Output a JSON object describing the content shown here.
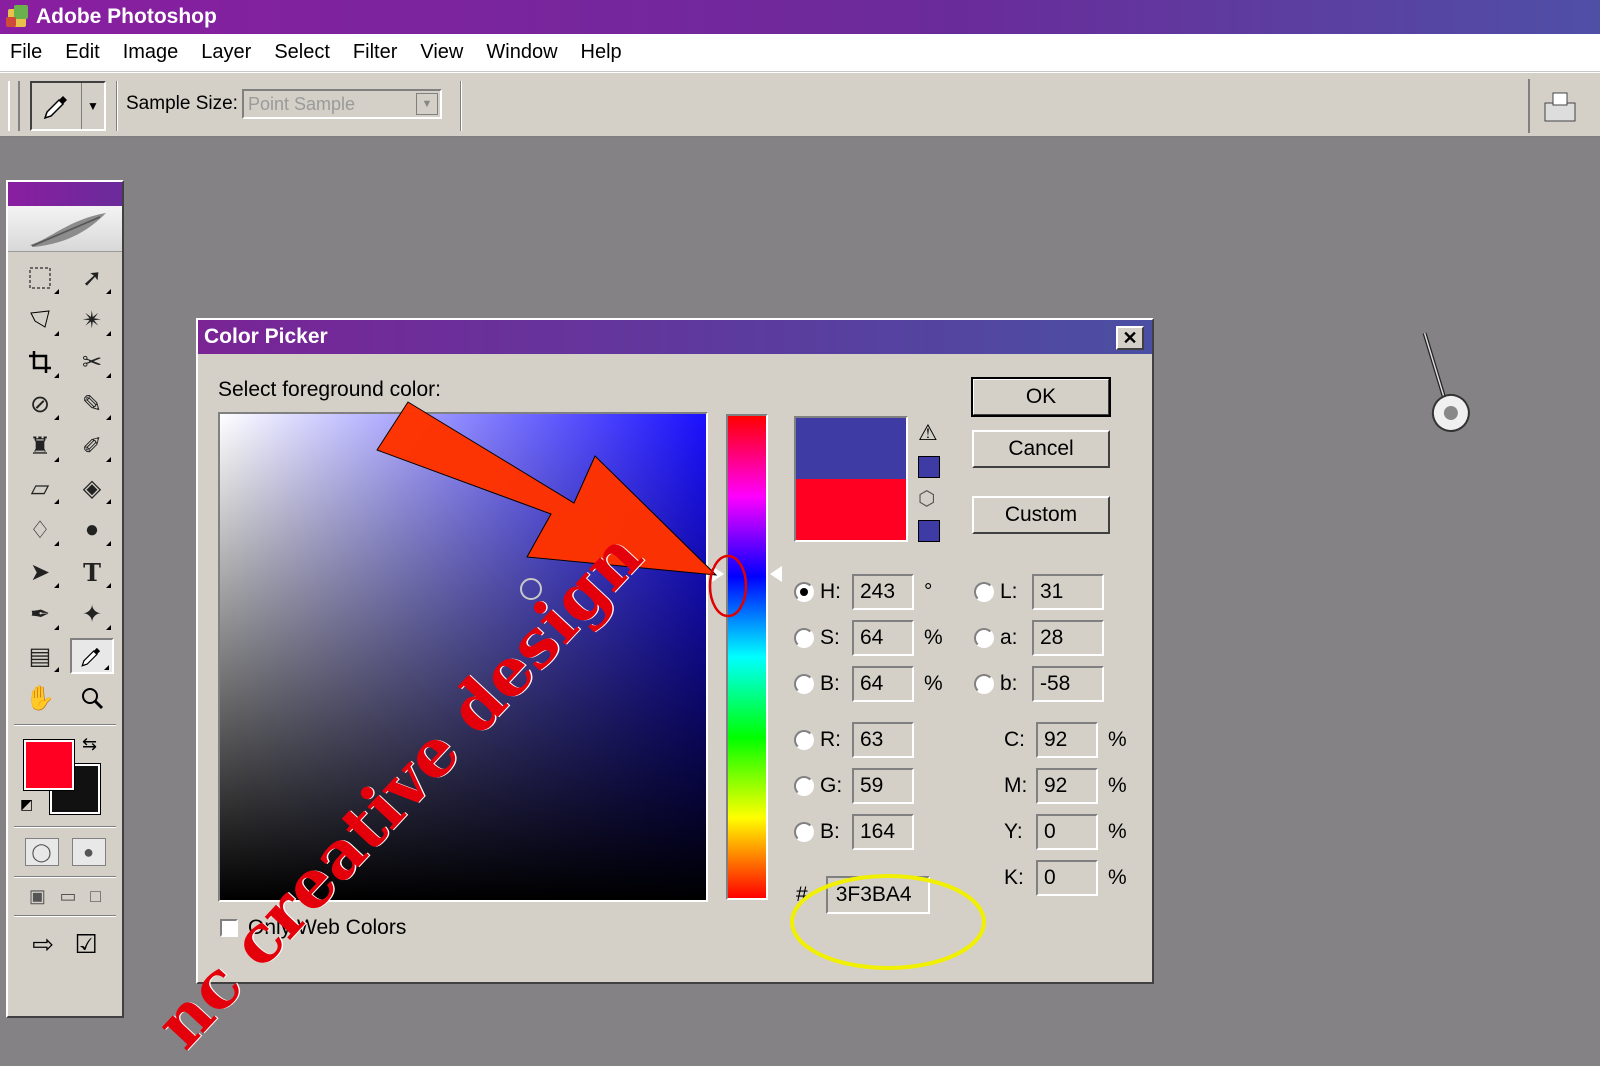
{
  "app": {
    "title": "Adobe Photoshop"
  },
  "menu": [
    "File",
    "Edit",
    "Image",
    "Layer",
    "Select",
    "Filter",
    "View",
    "Window",
    "Help"
  ],
  "options": {
    "sample_size_label": "Sample Size:",
    "sample_size_value": "Point Sample"
  },
  "toolbox": {
    "foreground_color": "#ff0022",
    "background_color": "#111111",
    "tools": [
      "marquee",
      "move",
      "lasso",
      "magic-wand",
      "crop",
      "slice",
      "healing-brush",
      "brush",
      "clone-stamp",
      "history-brush",
      "eraser",
      "paint-bucket",
      "blur",
      "dodge",
      "path-selection",
      "type",
      "pen",
      "custom-shape",
      "notes",
      "eyedropper",
      "hand",
      "zoom"
    ]
  },
  "dialog": {
    "title": "Color Picker",
    "close_label": "✕",
    "prompt": "Select foreground color:",
    "new_color": "#3f3ba4",
    "current_color": "#ff0022",
    "hue_base_color": "#1a10ff",
    "buttons": {
      "ok": "OK",
      "cancel": "Cancel",
      "custom": "Custom"
    },
    "hsb": {
      "h": {
        "label": "H:",
        "value": "243",
        "unit": "°",
        "selected": true
      },
      "s": {
        "label": "S:",
        "value": "64",
        "unit": "%"
      },
      "b": {
        "label": "B:",
        "value": "64",
        "unit": "%"
      }
    },
    "rgb": {
      "r": {
        "label": "R:",
        "value": "63"
      },
      "g": {
        "label": "G:",
        "value": "59"
      },
      "b": {
        "label": "B:",
        "value": "164"
      }
    },
    "lab": {
      "l": {
        "label": "L:",
        "value": "31"
      },
      "a": {
        "label": "a:",
        "value": "28"
      },
      "b": {
        "label": "b:",
        "value": "-58"
      }
    },
    "cmyk": {
      "c": {
        "label": "C:",
        "value": "92",
        "unit": "%"
      },
      "m": {
        "label": "M:",
        "value": "92",
        "unit": "%"
      },
      "y": {
        "label": "Y:",
        "value": "0",
        "unit": "%"
      },
      "k": {
        "label": "K:",
        "value": "0",
        "unit": "%"
      }
    },
    "hex": {
      "label": "#",
      "value": "3F3BA4"
    },
    "web_only_label": "Only Web Colors"
  },
  "annotations": {
    "watermark": "nc creative design",
    "arrow_color": "#ff3300",
    "highlight_ellipse_color": "#f0f000",
    "marker_ellipse_color": "#e00000"
  }
}
